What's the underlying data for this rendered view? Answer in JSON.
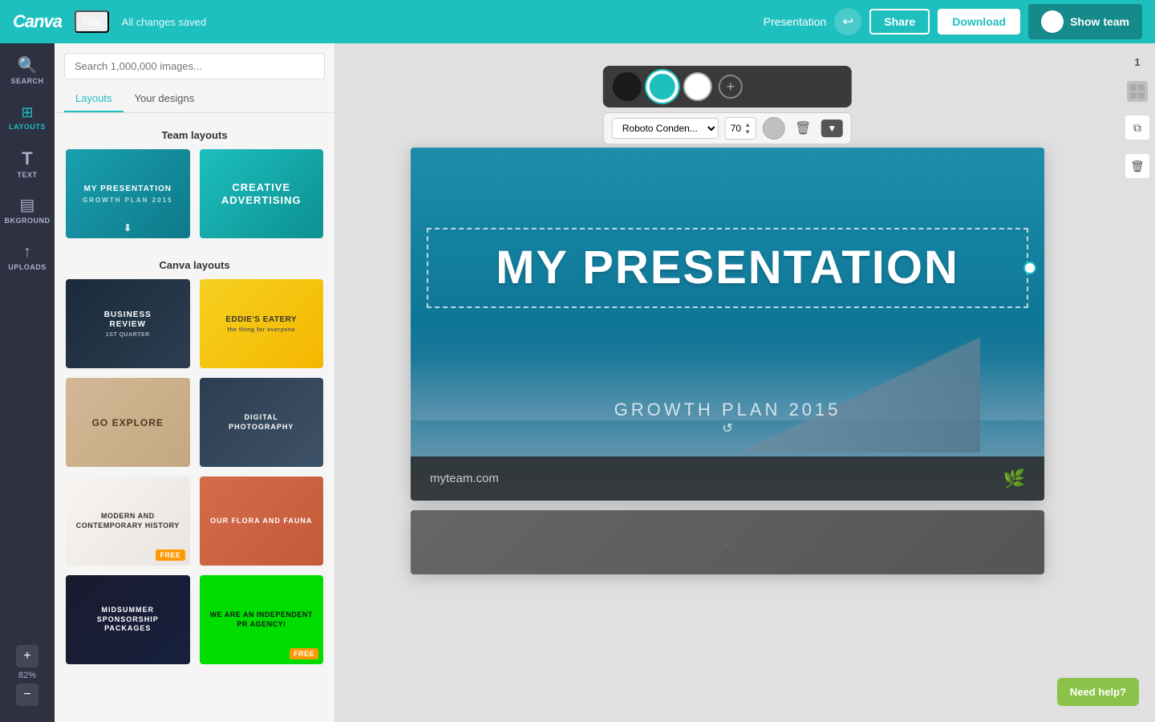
{
  "app": {
    "logo": "Canva",
    "status": "All changes saved"
  },
  "header": {
    "file_label": "File",
    "presentation_label": "Presentation",
    "share_label": "Share",
    "download_label": "Download",
    "show_team_label": "Show team",
    "undo_icon": "↩"
  },
  "sidebar": {
    "items": [
      {
        "id": "search",
        "label": "SEARCH",
        "icon": "🔍"
      },
      {
        "id": "layouts",
        "label": "LAYOUTS",
        "icon": "⊞",
        "active": true
      },
      {
        "id": "text",
        "label": "TEXT",
        "icon": "T"
      },
      {
        "id": "background",
        "label": "BKGROUND",
        "icon": "▤"
      },
      {
        "id": "uploads",
        "label": "UPLOADS",
        "icon": "↑"
      }
    ],
    "zoom_plus": "+",
    "zoom_level": "82%",
    "zoom_minus": "−"
  },
  "panel": {
    "search_placeholder": "Search 1,000,000 images...",
    "tabs": [
      {
        "id": "layouts",
        "label": "Layouts",
        "active": true
      },
      {
        "id": "your-designs",
        "label": "Your designs",
        "active": false
      }
    ],
    "team_layouts_title": "Team layouts",
    "canva_layouts_title": "Canva layouts",
    "team_layouts": [
      {
        "id": "my-pres",
        "title": "MY PRESENTATION",
        "subtitle": "GROWTH PLAN 2015",
        "style": "card-my-pres"
      },
      {
        "id": "creative-adv",
        "title": "CREATIVE ADVERTISING",
        "subtitle": "",
        "style": "card-creative"
      }
    ],
    "canva_layouts": [
      {
        "id": "business-review",
        "title": "BUSINESS REVIEW",
        "subtitle": "1ST QUARTER",
        "style": "card-business",
        "free": false
      },
      {
        "id": "eddies-eatery",
        "title": "EDDIE'S EATERY",
        "subtitle": "the thing for everyone",
        "style": "card-eddies",
        "free": false
      },
      {
        "id": "go-explore",
        "title": "GO EXPLORE",
        "subtitle": "",
        "style": "card-explore",
        "free": false
      },
      {
        "id": "digital-photo",
        "title": "DIGITAL PHOTOGRAPHY",
        "subtitle": "",
        "style": "card-photography",
        "free": false
      },
      {
        "id": "modern-history",
        "title": "MODERN AND CONTEMPORARY HISTORY",
        "subtitle": "",
        "style": "card-history",
        "free": true
      },
      {
        "id": "flora-fauna",
        "title": "OUR FLORA AND FAUNA",
        "subtitle": "",
        "style": "card-flora",
        "free": false
      },
      {
        "id": "midsummer",
        "title": "MIDSUMMER",
        "subtitle": "SPONSORSHIP PACKAGES",
        "style": "card-midsummer",
        "free": false
      },
      {
        "id": "pr-agency",
        "title": "WE ARE AN INDEPENDENT PR AGENCY/",
        "subtitle": "",
        "style": "card-pr-agency",
        "free": true
      }
    ]
  },
  "toolbar": {
    "colors": [
      {
        "id": "black",
        "hex": "#1a1a1a",
        "selected": false
      },
      {
        "id": "blue",
        "hex": "#1dbfbf",
        "selected": true
      },
      {
        "id": "white",
        "hex": "#ffffff",
        "selected": false
      }
    ],
    "add_color_label": "+",
    "font_name": "Roboto Conden...",
    "font_size": "70",
    "text_color_hex": "#c0c0c0"
  },
  "slide": {
    "main_title": "MY PRESENTATION",
    "subtitle": "GROWTH PLAN 2015",
    "footer_url": "myteam.com"
  },
  "right_panel": {
    "page_number": "1"
  },
  "help_btn_label": "Need help?"
}
